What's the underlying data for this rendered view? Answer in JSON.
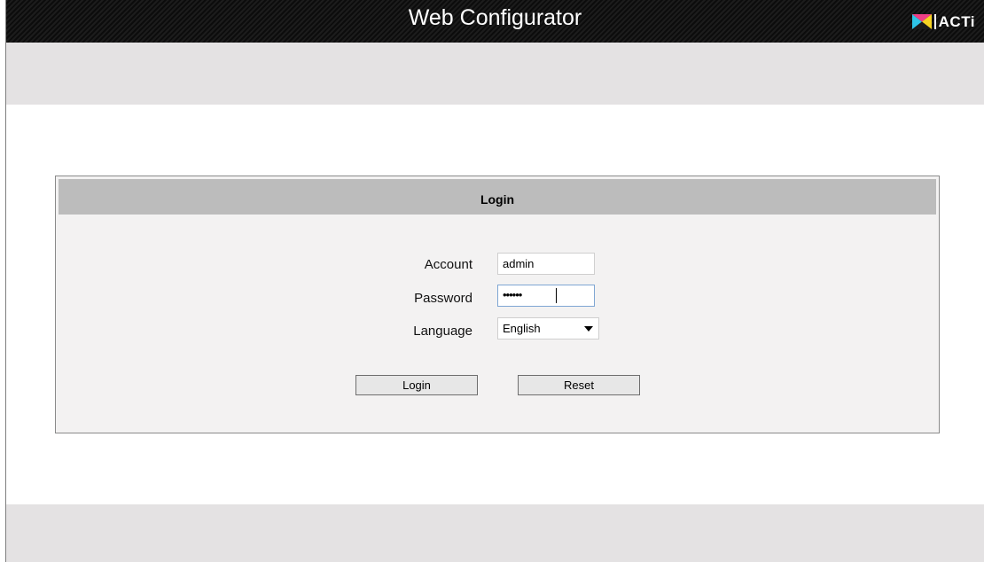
{
  "header": {
    "title": "Web Configurator",
    "brand_text": "ACTi",
    "brand_colors": [
      "#2ec4e6",
      "#ef3f86",
      "#f6d322",
      "#1a1a1a"
    ]
  },
  "login": {
    "heading": "Login",
    "fields": {
      "account": {
        "label": "Account",
        "value": "admin"
      },
      "password": {
        "label": "Password",
        "masked_value": "••••••"
      },
      "language": {
        "label": "Language",
        "selected": "English"
      }
    },
    "buttons": {
      "login": "Login",
      "reset": "Reset"
    }
  }
}
